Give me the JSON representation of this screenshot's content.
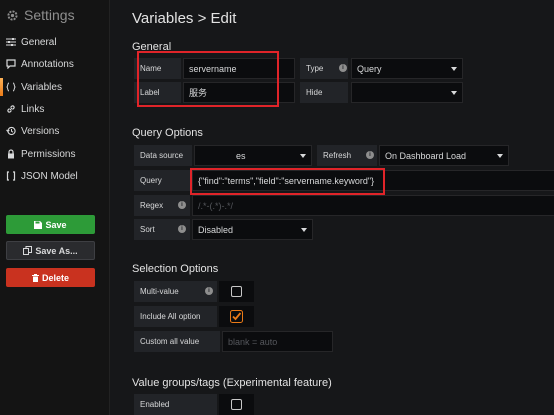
{
  "sidebar": {
    "title": "Settings",
    "items": [
      {
        "label": "General",
        "icon": "sliders-icon"
      },
      {
        "label": "Annotations",
        "icon": "comment-icon"
      },
      {
        "label": "Variables",
        "icon": "code-braces-icon"
      },
      {
        "label": "Links",
        "icon": "link-icon"
      },
      {
        "label": "Versions",
        "icon": "history-icon"
      },
      {
        "label": "Permissions",
        "icon": "lock-icon"
      },
      {
        "label": "JSON Model",
        "icon": "json-icon"
      }
    ],
    "active_item": "Variables",
    "save_label": "Save",
    "save_as_label": "Save As...",
    "delete_label": "Delete"
  },
  "page": {
    "title": "Variables > Edit"
  },
  "general": {
    "section_title": "General",
    "name_label": "Name",
    "name_value": "servername",
    "type_label": "Type",
    "type_value": "Query",
    "label_label": "Label",
    "label_value": "服务",
    "hide_label": "Hide",
    "hide_value": ""
  },
  "query_options": {
    "section_title": "Query Options",
    "datasource_label": "Data source",
    "datasource_value": "es",
    "refresh_label": "Refresh",
    "refresh_value": "On Dashboard Load",
    "query_label": "Query",
    "query_value": "{\"find\":\"terms\",\"field\":\"servername.keyword\"}",
    "regex_label": "Regex",
    "regex_placeholder": "/.*-(.*)-.*/",
    "sort_label": "Sort",
    "sort_value": "Disabled"
  },
  "selection_options": {
    "section_title": "Selection Options",
    "multi_value_label": "Multi-value",
    "multi_value_checked": false,
    "include_all_label": "Include All option",
    "include_all_checked": true,
    "custom_all_label": "Custom all value",
    "custom_all_placeholder": "blank = auto"
  },
  "value_groups": {
    "section_title": "Value groups/tags (Experimental feature)",
    "enabled_label": "Enabled",
    "enabled_checked": false
  },
  "colors": {
    "accent": "#eb7b18",
    "save": "#2d9b38",
    "delete": "#c9321f",
    "highlight": "#e02429"
  }
}
